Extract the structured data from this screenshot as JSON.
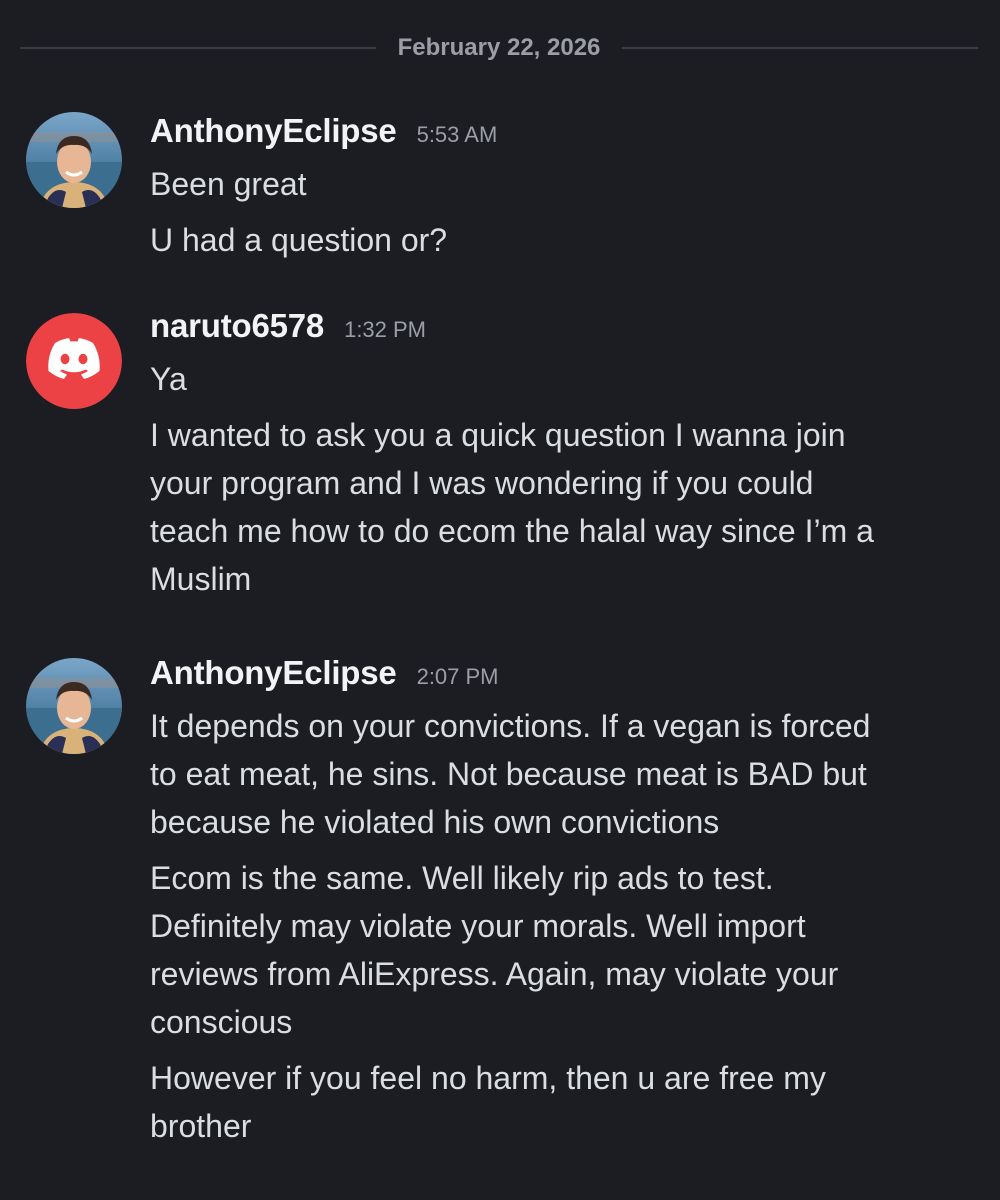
{
  "date_divider": {
    "label": "February 22, 2026"
  },
  "messages": [
    {
      "author": "AnthonyEclipse",
      "avatar": "profile-photo",
      "time": "5:53 AM",
      "lines": [
        "Been great",
        "U had a question or?"
      ]
    },
    {
      "author": "naruto6578",
      "avatar": "discord-default-avatar",
      "avatar_color": "#ed4245",
      "time": "1:32 PM",
      "lines": [
        "Ya",
        "I wanted to ask you a quick question I wanna join\nyour program and I was wondering if you could\nteach me how to do ecom the halal way since I’m a\nMuslim"
      ]
    },
    {
      "author": "AnthonyEclipse",
      "avatar": "profile-photo",
      "time": "2:07 PM",
      "lines": [
        "It depends on your convictions. If a vegan is forced\nto eat meat, he sins. Not because meat is BAD but\nbecause he violated his own convictions",
        "Ecom is the same. Well likely rip ads to test.\nDefinitely may violate your morals. Well import\nreviews from AliExpress. Again, may violate your\nconscious",
        "However if you feel no harm, then u are free my\nbrother"
      ]
    }
  ],
  "colors": {
    "background": "#1c1d22",
    "username": "#f2f3f5",
    "message_text": "#dbdee1",
    "timestamp": "#9b9ea6",
    "divider_line": "#3a3c43"
  }
}
